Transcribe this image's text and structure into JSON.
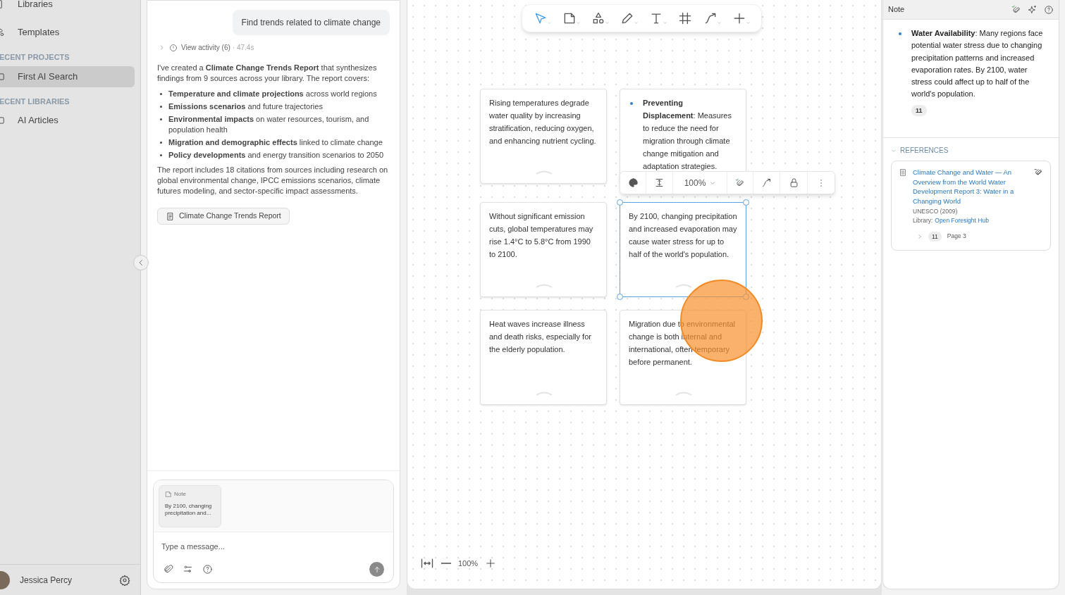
{
  "sidebar": {
    "nav": [
      {
        "label": "Libraries"
      },
      {
        "label": "Templates"
      }
    ],
    "sections": [
      {
        "title": "ECENT PROJECTS",
        "items": [
          {
            "label": "First AI Search",
            "selected": true
          }
        ]
      },
      {
        "title": "ECENT LIBRARIES",
        "items": [
          {
            "label": "AI Articles",
            "selected": false
          }
        ]
      }
    ],
    "user": {
      "name": "Jessica Percy"
    }
  },
  "chat": {
    "user_message": "Find trends related to climate change",
    "activity": {
      "label": "View activity (6)",
      "time": "· 47.4s"
    },
    "intro": "I've created a **Climate Change Trends Report** that synthesizes findings from 9 sources across your library. The report covers:",
    "bullets": [
      "**Temperature and climate projections** across world regions",
      "**Emissions scenarios** and future trajectories",
      "**Environmental impacts** on water resources, tourism, and population health",
      "**Migration and demographic effects** linked to climate change",
      "**Policy developments** and energy transition scenarios to 2050"
    ],
    "closing": "The report includes 18 citations from sources including research on global environmental change, IPCC emissions scenarios, climate futures modeling, and sector-specific impact assessments.",
    "report_button": "Climate Change Trends Report",
    "composer": {
      "attachment": {
        "title": "Note",
        "text": "By 2100, changing precipitation and..."
      },
      "placeholder": "Type a message..."
    }
  },
  "canvas": {
    "tools": [
      {
        "kind": "select",
        "selected": true
      },
      {
        "kind": "note",
        "selected": false
      },
      {
        "kind": "shapes",
        "selected": false
      },
      {
        "kind": "pen",
        "selected": false
      },
      {
        "kind": "text",
        "selected": false
      },
      {
        "kind": "frame",
        "selected": false
      },
      {
        "kind": "connector",
        "selected": false
      },
      {
        "kind": "add",
        "selected": false
      }
    ],
    "cards": [
      {
        "kind": "text",
        "text": "Rising temperatures degrade water quality by increasing stratification, reducing oxygen, and enhancing nutrient cycling.",
        "selected": false
      },
      {
        "kind": "bullet",
        "text": "**Preventing Displacement**: Measures to reduce the need for migration through climate change mitigation and adaptation strategies.",
        "selected": false
      },
      {
        "kind": "text",
        "text": "Without significant emission cuts, global temperatures may rise 1.4°C to 5.8°C from 1990 to 2100.",
        "selected": false
      },
      {
        "kind": "text",
        "text": "By 2100, changing precipitation and increased evaporation may cause water stress for up to half of the world's population.",
        "selected": true
      },
      {
        "kind": "text",
        "text": "Heat waves increase illness and death risks, especially for the elderly population.",
        "selected": false
      },
      {
        "kind": "text",
        "text": "Migration due to environmental change is both internal and international, often temporary before permanent.",
        "selected": false
      }
    ],
    "card_toolbar": {
      "zoom": "100%"
    },
    "zoom": "100%"
  },
  "note_panel": {
    "title": "Note",
    "note": "**Water Availability**: Many regions face potential water stress due to changing precipitation patterns and increased evaporation rates. By 2100, water stress could affect up to half of the world's population.",
    "citation": "11",
    "references": {
      "title": "REFERENCES",
      "expanded": true,
      "items": [
        {
          "title": "Climate Change and Water — An Overview from the World Water Development Report 3: Water in a Changing World",
          "source": "UNESCO (2009)",
          "library_label": "Library:",
          "library": "Open Foresight Hub",
          "citation": "11",
          "page": "Page 3"
        }
      ]
    }
  }
}
